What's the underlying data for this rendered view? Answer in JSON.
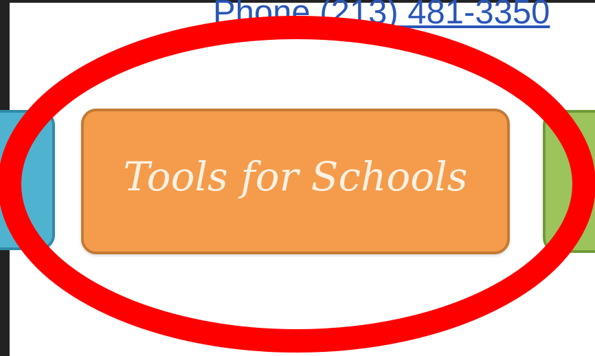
{
  "header": {
    "phone_text": "Phone (213) 481-3350"
  },
  "nav": {
    "tools_button_label": "Tools for Schools"
  },
  "colors": {
    "orange_button": "#f49c4b",
    "blue_button": "#4fb3cf",
    "green_button": "#9cc35c",
    "annotation_circle": "#ff0000",
    "phone_link": "#2a56b8"
  }
}
